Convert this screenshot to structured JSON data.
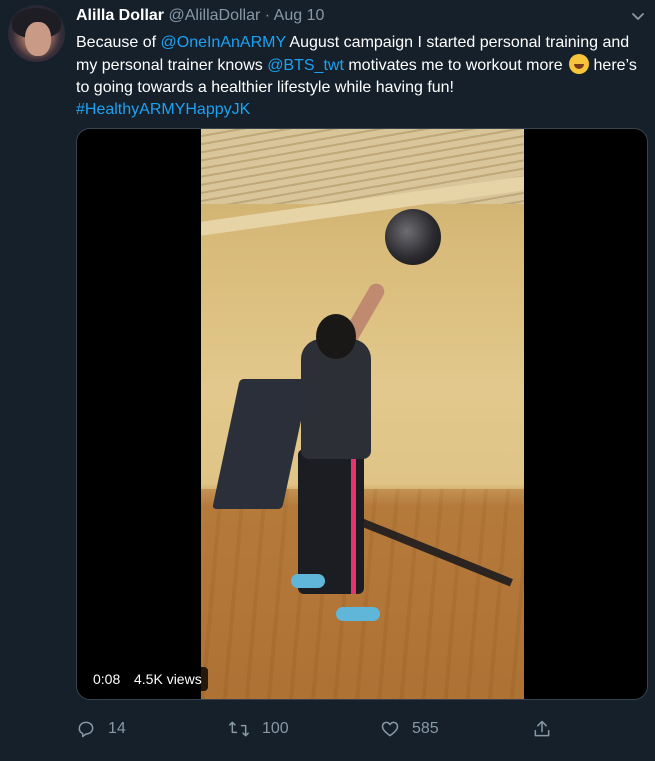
{
  "tweet": {
    "display_name": "Alilla Dollar",
    "handle": "@AlillaDollar",
    "separator": "·",
    "date": "Aug 10",
    "text_1": "Because of ",
    "mention_1": "@OneInAnARMY",
    "text_2": " August campaign I started personal training and my personal trainer knows ",
    "mention_2": "@BTS_twt",
    "text_3": " motivates me to workout more ",
    "text_4": " here’s to going towards a healthier lifestyle while having fun!",
    "hashtag": "#HealthyARMYHappyJK",
    "emoji": "grinning-squinting-face",
    "caret_icon": "chevron-down-icon"
  },
  "video": {
    "duration": "0:08",
    "views": "4.5K views"
  },
  "actions": {
    "reply_count": "14",
    "retweet_count": "100",
    "like_count": "585",
    "share_icon": "share-icon"
  },
  "colors": {
    "background": "#15202b",
    "link": "#1da1f2",
    "muted": "#8899a6"
  }
}
